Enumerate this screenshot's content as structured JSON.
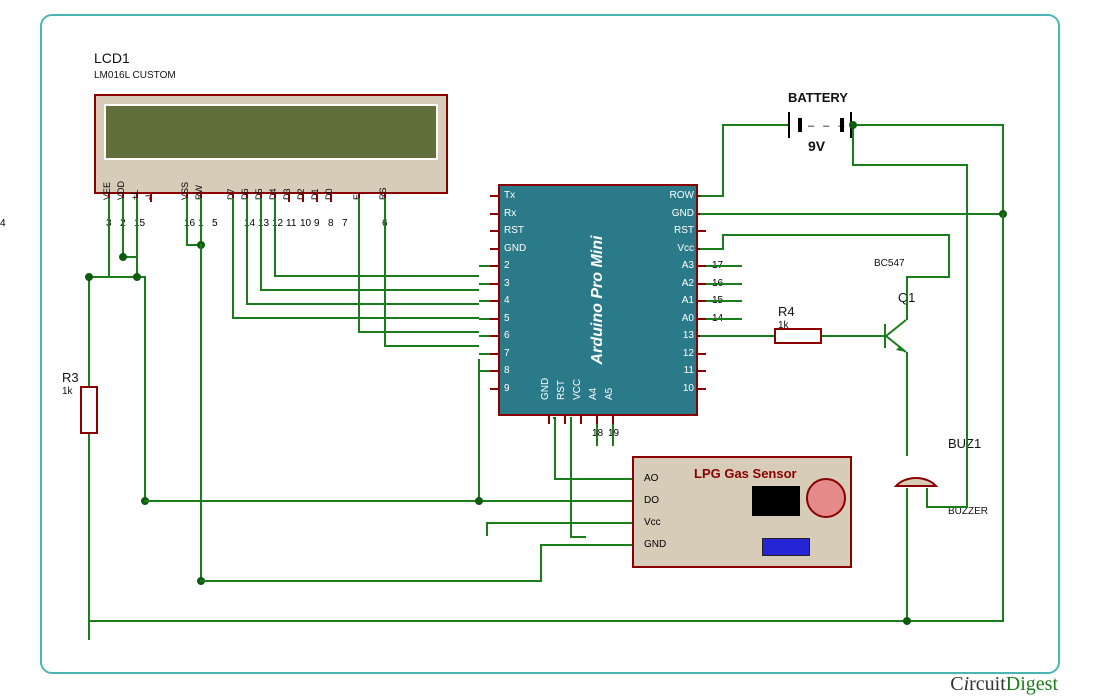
{
  "lcd": {
    "ref": "LCD1",
    "part": "LM016L CUSTOM",
    "pins": [
      "VEE",
      "VDD",
      "+L",
      "-L",
      "",
      "VSS",
      "RW",
      "",
      "D7",
      "D6",
      "D5",
      "D4",
      "D3",
      "D2",
      "D1",
      "D0",
      "",
      "E",
      "RS"
    ],
    "nums": [
      "3",
      "2",
      "15",
      "",
      "",
      "16",
      "1",
      "5",
      "",
      "14",
      "13",
      "12",
      "11",
      "10",
      "9",
      "8",
      "7",
      "",
      "6",
      "4"
    ]
  },
  "arduino": {
    "name": "Arduino Pro Mini",
    "left": [
      "Tx",
      "Rx",
      "RST",
      "GND",
      "2",
      "3",
      "4",
      "5",
      "6",
      "7",
      "8",
      "9"
    ],
    "right": [
      "ROW",
      "GND",
      "RST",
      "Vcc",
      "A3",
      "A2",
      "A1",
      "A0",
      "13",
      "12",
      "11",
      "10"
    ],
    "rightnums": [
      "",
      "",
      "",
      "",
      "17",
      "16",
      "15",
      "14",
      "",
      "",
      "",
      ""
    ],
    "bottom": [
      "GND",
      "RST",
      "VCC",
      "A4",
      "A5"
    ],
    "bottomnums": [
      "",
      "",
      "",
      "18",
      "19"
    ]
  },
  "battery": {
    "label": "BATTERY",
    "value": "9V"
  },
  "r3": {
    "ref": "R3",
    "value": "1k"
  },
  "r4": {
    "ref": "R4",
    "value": "1k"
  },
  "q1": {
    "ref": "Q1",
    "part": "BC547"
  },
  "sensor": {
    "title": "LPG Gas Sensor",
    "pins": [
      "AO",
      "DO",
      "Vcc",
      "GND"
    ]
  },
  "buzzer": {
    "ref": "BUZ1",
    "type": "BUZZER"
  },
  "watermark": "CircuitDigest"
}
